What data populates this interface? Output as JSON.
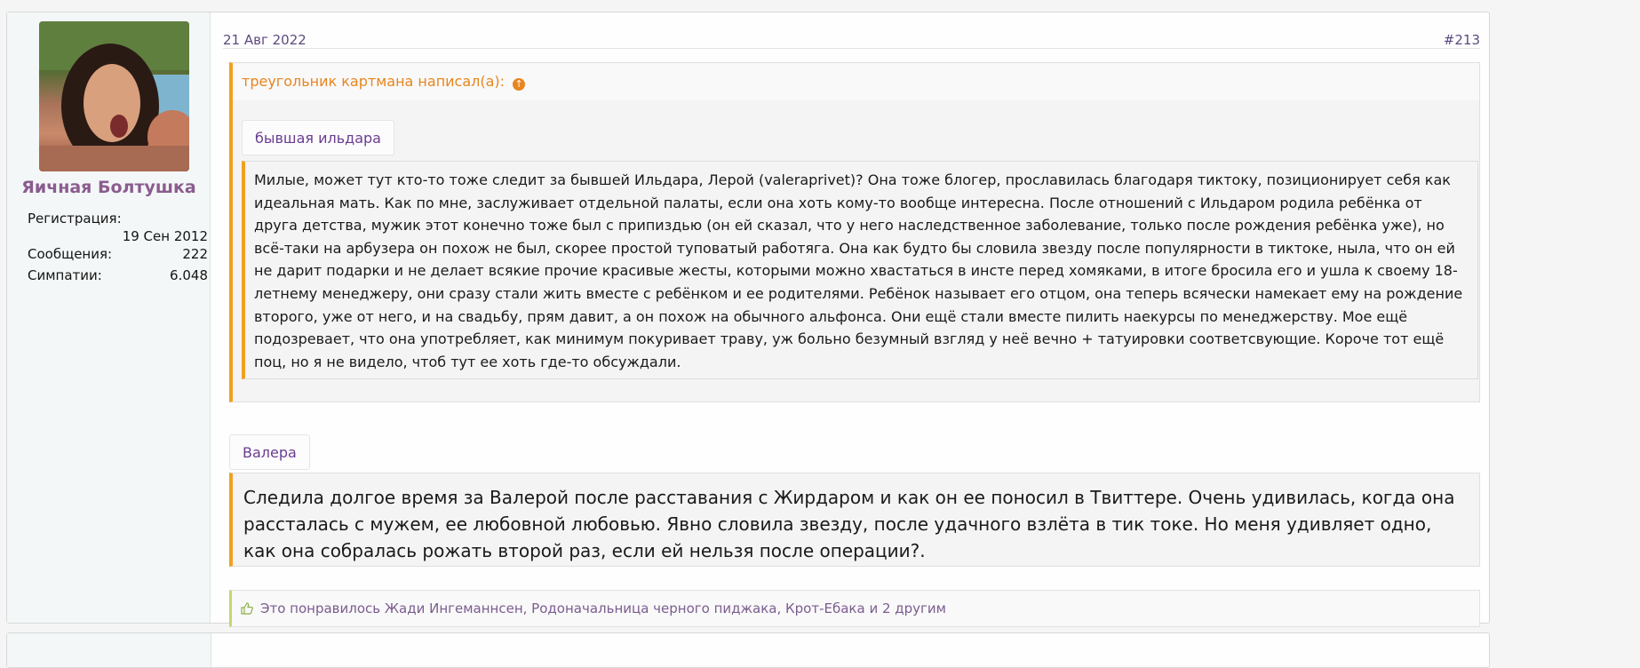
{
  "post": {
    "author": {
      "username": "Яичная Болтушка",
      "stats": [
        {
          "label": "Регистрация:",
          "value": "19 Сен 2012"
        },
        {
          "label": "Сообщения:",
          "value": "222"
        },
        {
          "label": "Симпатии:",
          "value": "6.048"
        }
      ]
    },
    "date": "21 Авг 2022",
    "number": "#213",
    "quote": {
      "header": "треугольник картмана написал(а):",
      "spoiler_label": "бывшая ильдара",
      "text": "Милые, может тут кто-то тоже следит за бывшей Ильдара, Лерой (valeraprivet)? Она тоже блогер, прославилась благодаря тиктоку, позиционирует себя как идеальная мать. Как по мне, заслуживает отдельной палаты, если она хоть кому-то вообще интересна. После отношений с Ильдаром родила ребёнка от друга детства, мужик этот конечно тоже был с припиздью (он ей сказал, что у него наследственное заболевание, только после рождения ребёнка уже), но всё-таки на арбузера он похож не был, скорее простой туповатый работяга. Она как будто бы словила звезду после популярности в тиктоке, ныла, что он ей не дарит подарки и не делает всякие прочие красивые жесты, которыми можно хвастаться в инсте перед хомяками, в итоге бросила его и ушла к своему 18-летнему менеджеру, они сразу стали жить вместе с ребёнком и ее родителями. Ребёнок называет его отцом, она теперь всячески намекает ему на рождение второго, уже от него, и на свадьбу, прям давит, а он похож на обычного альфонса. Они ещё стали вместе пилить наекурсы по менеджерству. Мое ещё подозревает, что она употребляет, как минимум покуривает траву, уж больно безумный взгляд у неё вечно + татуировки соответсвующие. Короче тот ещё поц, но я не видело, чтоб тут ее хоть где-то обсуждали."
    },
    "spoiler_label": "Валера",
    "body": "Следила долгое время за Валерой после расставания с Жирдаром и как он ее поносил в Твиттере. Очень удивилась, когда она рассталась с мужем, ее любовной любовью. Явно словила звезду, после удачного взлёта в тик токе. Но меня удивляет одно, как она собралась рожать второй раз, если ей нельзя после операции?.",
    "likes": "Это понравилось Жади Ингеманнсен, Родоначальница черного пиджака, Крот-Ебака и 2 другим"
  },
  "icons": {
    "quote_jump": "arrow-up-circle-icon",
    "like": "thumbs-up-icon"
  },
  "colors": {
    "accent": "#f0a020",
    "username": "#8a5c8f",
    "link": "#6a3d91",
    "quote_head": "#e8851f"
  }
}
